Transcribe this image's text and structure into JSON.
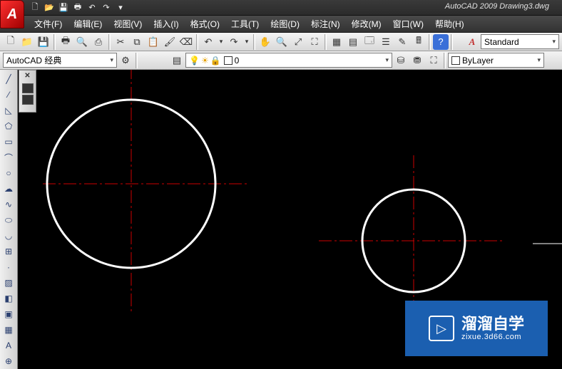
{
  "app": {
    "logo_letter": "A",
    "title": "AutoCAD 2009 Drawing3.dwg"
  },
  "qat": {
    "new": "🗋",
    "open": "📂",
    "save": "💾",
    "print": "🖶",
    "undo": "↶",
    "redo": "↷",
    "down": "▾"
  },
  "menu": {
    "file": "文件(F)",
    "edit": "编辑(E)",
    "view": "视图(V)",
    "insert": "插入(I)",
    "format": "格式(O)",
    "tools": "工具(T)",
    "draw": "绘图(D)",
    "dimension": "标注(N)",
    "modify": "修改(M)",
    "window": "窗口(W)",
    "help": "帮助(H)"
  },
  "toolbar1": {
    "new": "🗋",
    "open": "📁",
    "save": "💾",
    "print": "🖶",
    "preview": "🔍",
    "publish": "⎙",
    "cut": "✂",
    "copy": "⧉",
    "paste": "📋",
    "match": "🖌",
    "eraser": "⌫",
    "undo": "↶",
    "redo": "↷",
    "down1": "▾",
    "down2": "▾",
    "pan": "✋",
    "zoomr": "🔍",
    "zoomw": "⤢",
    "zoome": "⛶",
    "prop": "▦",
    "dc": "▤",
    "tool": "🗔",
    "sheet": "☰",
    "markup": "✎",
    "calc": "🖩",
    "help": "?",
    "a": "A",
    "style_label": "Standard",
    "style_down": "▾"
  },
  "toolbar2": {
    "workspace": "AutoCAD 经典",
    "ws_gear": "⚙",
    "ws_down": "▾",
    "layer_state": "▤",
    "bulb": "💡",
    "sun": "☀",
    "lock": "🔒",
    "color": "▢",
    "layer_name": "0",
    "layer_down": "▾",
    "lm": "⛁",
    "lp": "⛃",
    "ls": "⛶",
    "bylayer": "ByLayer",
    "bylayer_down": "▾"
  },
  "draw_tools": {
    "line": "╱",
    "cline": "⁄",
    "pline": "◺",
    "polygon": "⬠",
    "rect": "▭",
    "arc": "⌒",
    "circle": "○",
    "revcloud": "☁",
    "spline": "∿",
    "ellipse": "⬭",
    "earc": "◡",
    "block": "⊞",
    "point": "·",
    "hatch": "▨",
    "grad": "◧",
    "region": "▣",
    "table": "▦",
    "mtext": "A",
    "add": "⊕"
  },
  "panel2": {
    "close": "✕"
  },
  "watermark": {
    "icon": "▷",
    "brand": "溜溜自学",
    "url": "zixue.3d66.com"
  }
}
